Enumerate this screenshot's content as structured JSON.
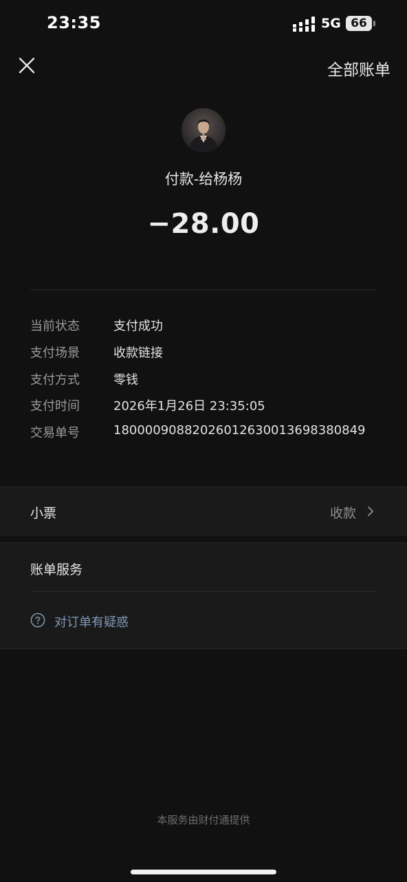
{
  "status_bar": {
    "time": "23:35",
    "network": "5G",
    "battery": "66",
    "signal_icon": "signal-icon"
  },
  "header": {
    "close_icon": "close-icon",
    "all_bills_label": "全部账单"
  },
  "payee": {
    "avatar_icon": "avatar",
    "title": "付款-给杨杨",
    "amount": "−28.00"
  },
  "details": [
    {
      "label": "当前状态",
      "value": "支付成功"
    },
    {
      "label": "支付场景",
      "value": "收款链接"
    },
    {
      "label": "支付方式",
      "value": "零钱"
    },
    {
      "label": "支付时间",
      "value": "2026年1月26日 23:35:05"
    },
    {
      "label": "交易单号",
      "value": "18000090882026012630013698380849"
    }
  ],
  "ticket": {
    "label": "小票",
    "value": "收款",
    "icon": "chevron-right-icon"
  },
  "service": {
    "title": "账单服务",
    "question_text": "对订单有疑惑",
    "question_icon": "question-circle-icon"
  },
  "footer": {
    "text": "本服务由财付通提供"
  },
  "colors": {
    "background": "#111111",
    "section_background": "#1a1a1a",
    "link": "#7f9ab8",
    "muted": "#9a9a9a"
  }
}
